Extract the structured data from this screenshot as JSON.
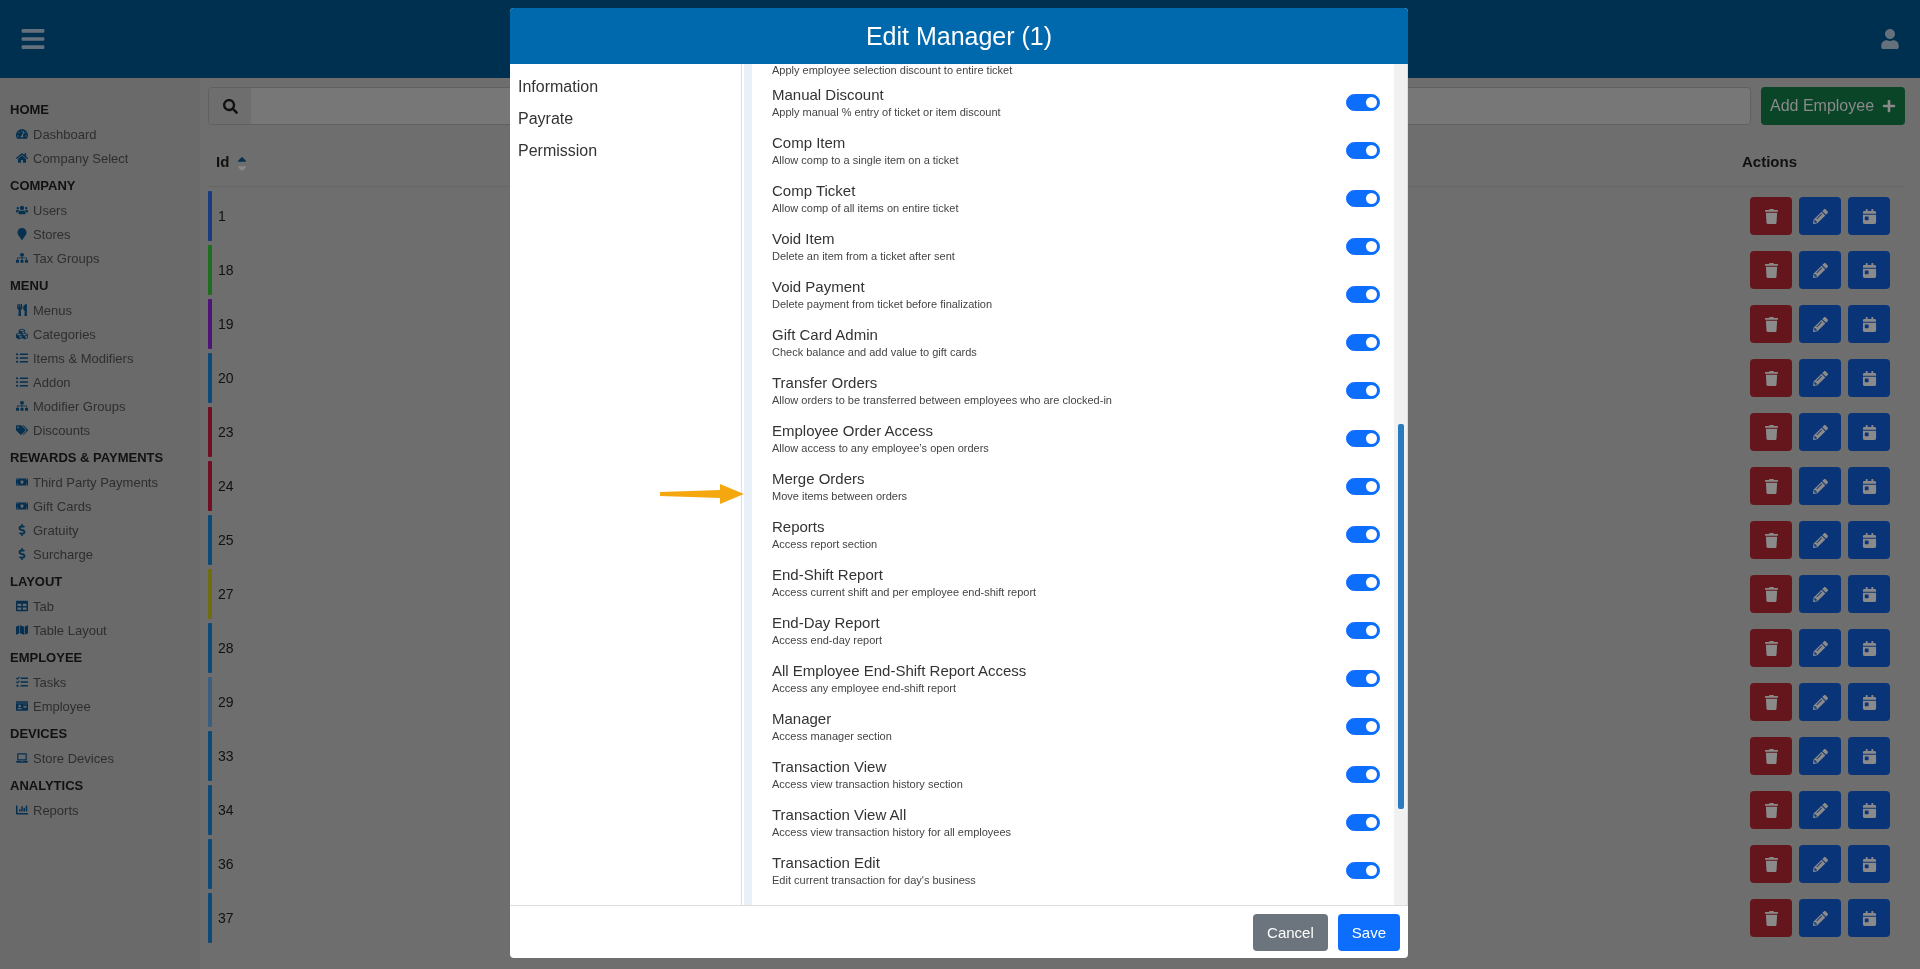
{
  "sidebar": {
    "sections": [
      {
        "title": "HOME",
        "items": [
          "Dashboard",
          "Company Select"
        ]
      },
      {
        "title": "COMPANY",
        "items": [
          "Users",
          "Stores",
          "Tax Groups"
        ]
      },
      {
        "title": "MENU",
        "items": [
          "Menus",
          "Categories",
          "Items & Modifiers",
          "Addon",
          "Modifier Groups",
          "Discounts"
        ]
      },
      {
        "title": "REWARDS & PAYMENTS",
        "items": [
          "Third Party Payments",
          "Gift Cards",
          "Gratuity",
          "Surcharge"
        ]
      },
      {
        "title": "LAYOUT",
        "items": [
          "Tab",
          "Table Layout"
        ]
      },
      {
        "title": "EMPLOYEE",
        "items": [
          "Tasks",
          "Employee"
        ]
      },
      {
        "title": "DEVICES",
        "items": [
          "Store Devices"
        ]
      },
      {
        "title": "ANALYTICS",
        "items": [
          "Reports"
        ]
      }
    ]
  },
  "toolbar": {
    "add_button": "Add Employee"
  },
  "table": {
    "columns": [
      {
        "label": "Id",
        "sorted_ascending": true
      },
      {
        "label": "Actions"
      }
    ],
    "rows": [
      {
        "id": "1",
        "color": "#1a3a80"
      },
      {
        "id": "18",
        "color": "#1f6e1f"
      },
      {
        "id": "19",
        "color": "#4d1475"
      },
      {
        "id": "20",
        "color": "#0e4a78"
      },
      {
        "id": "23",
        "color": "#700f24"
      },
      {
        "id": "24",
        "color": "#700f24"
      },
      {
        "id": "25",
        "color": "#0e4a78"
      },
      {
        "id": "27",
        "color": "#6e6e10"
      },
      {
        "id": "28",
        "color": "#0e4a78"
      },
      {
        "id": "29",
        "color": "#3a5e7c"
      },
      {
        "id": "33",
        "color": "#0e4a78"
      },
      {
        "id": "34",
        "color": "#0e4a78"
      },
      {
        "id": "36",
        "color": "#0e4a78"
      },
      {
        "id": "37",
        "color": "#0e4a78"
      }
    ]
  },
  "modal": {
    "title": "Edit Manager (1)",
    "nav": [
      "Information",
      "Payrate",
      "Permission"
    ],
    "lead_description": "Apply employee selection discount to entire ticket",
    "permissions": [
      {
        "name": "Manual Discount",
        "description": "Apply manual % entry of ticket or item discount",
        "on": true
      },
      {
        "name": "Comp Item",
        "description": "Allow comp to a single item on a ticket",
        "on": true
      },
      {
        "name": "Comp Ticket",
        "description": "Allow comp of all items on entire ticket",
        "on": true
      },
      {
        "name": "Void Item",
        "description": "Delete an item from a ticket after sent",
        "on": true
      },
      {
        "name": "Void Payment",
        "description": "Delete payment from ticket before finalization",
        "on": true
      },
      {
        "name": "Gift Card Admin",
        "description": "Check balance and add value to gift cards",
        "on": true
      },
      {
        "name": "Transfer Orders",
        "description": "Allow orders to be transferred between employees who are clocked-in",
        "on": true
      },
      {
        "name": "Employee Order Access",
        "description": "Allow access to any employee’s open orders",
        "on": true
      },
      {
        "name": "Merge Orders",
        "description": "Move items between orders",
        "on": true,
        "highlighted": true
      },
      {
        "name": "Reports",
        "description": "Access report section",
        "on": true
      },
      {
        "name": "End-Shift Report",
        "description": "Access current shift and per employee end-shift report",
        "on": true
      },
      {
        "name": "End-Day Report",
        "description": "Access end-day report",
        "on": true
      },
      {
        "name": "All Employee End-Shift Report Access",
        "description": "Access any employee end-shift report",
        "on": true
      },
      {
        "name": "Manager",
        "description": "Access manager section",
        "on": true
      },
      {
        "name": "Transaction View",
        "description": "Access view transaction history section",
        "on": true
      },
      {
        "name": "Transaction View All",
        "description": "Access view transaction history for all employees",
        "on": true
      },
      {
        "name": "Transaction Edit",
        "description": "Edit current transaction for day's business",
        "on": true
      }
    ],
    "buttons": [
      {
        "label": "Cancel",
        "kind": "secondary"
      },
      {
        "label": "Save",
        "kind": "primary"
      }
    ]
  }
}
